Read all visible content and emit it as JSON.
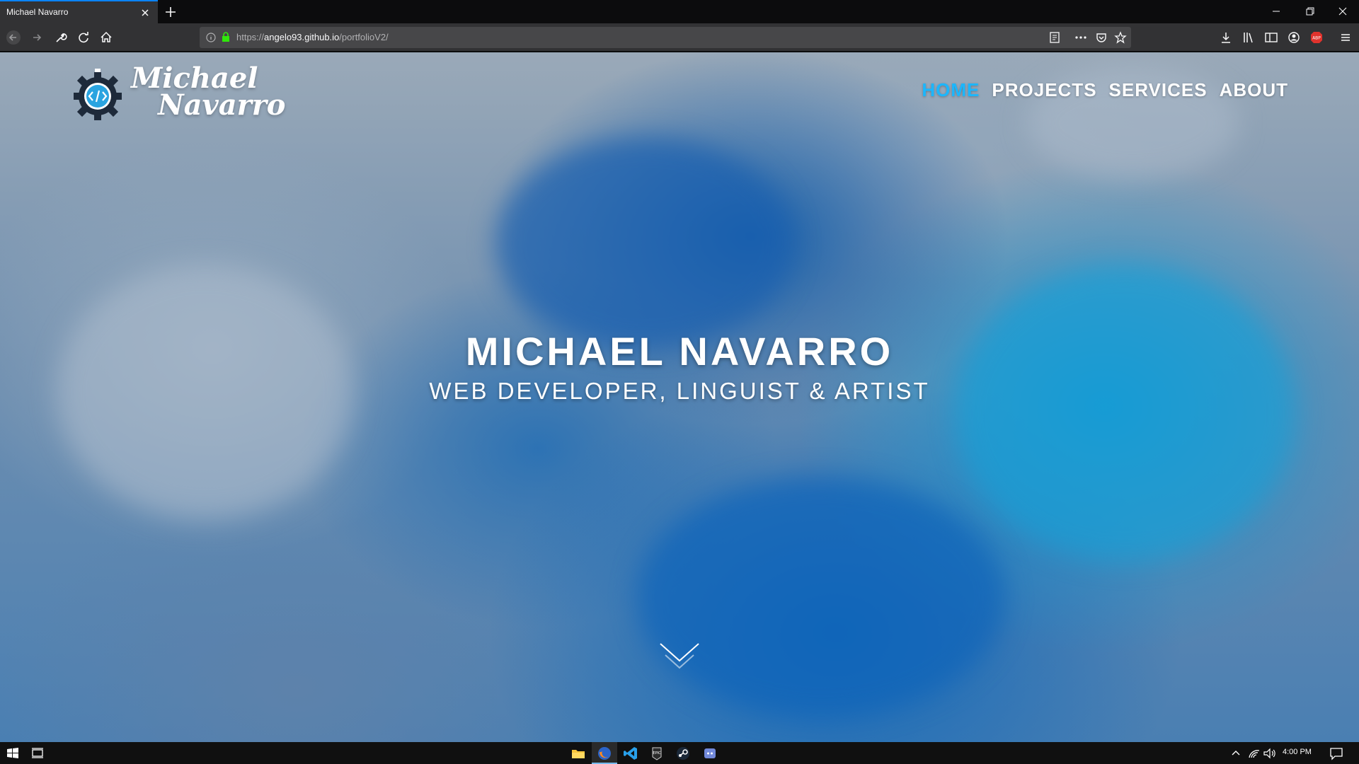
{
  "browser": {
    "tab_title": "Michael Navarro",
    "url_prefix": "https://",
    "url_host": "angelo93.github.io",
    "url_path": "/portfolioV2/"
  },
  "site": {
    "brand_line1": "Michael",
    "brand_line2": "Navarro",
    "nav": [
      "HOME",
      "PROJECTS",
      "SERVICES",
      "ABOUT"
    ],
    "active_nav": "HOME",
    "hero_title": "MICHAEL NAVARRO",
    "hero_subtitle": "WEB DEVELOPER, LINGUIST & ARTIST"
  },
  "colors": {
    "accent": "#1bb7ff",
    "chrome": "#323234",
    "tab_highlight": "#0a84ff"
  },
  "taskbar": {
    "clock": "4:00 PM",
    "apps": [
      "file-explorer-icon",
      "firefox-icon",
      "vscode-icon",
      "epic-games-icon",
      "steam-icon",
      "discord-icon"
    ]
  }
}
